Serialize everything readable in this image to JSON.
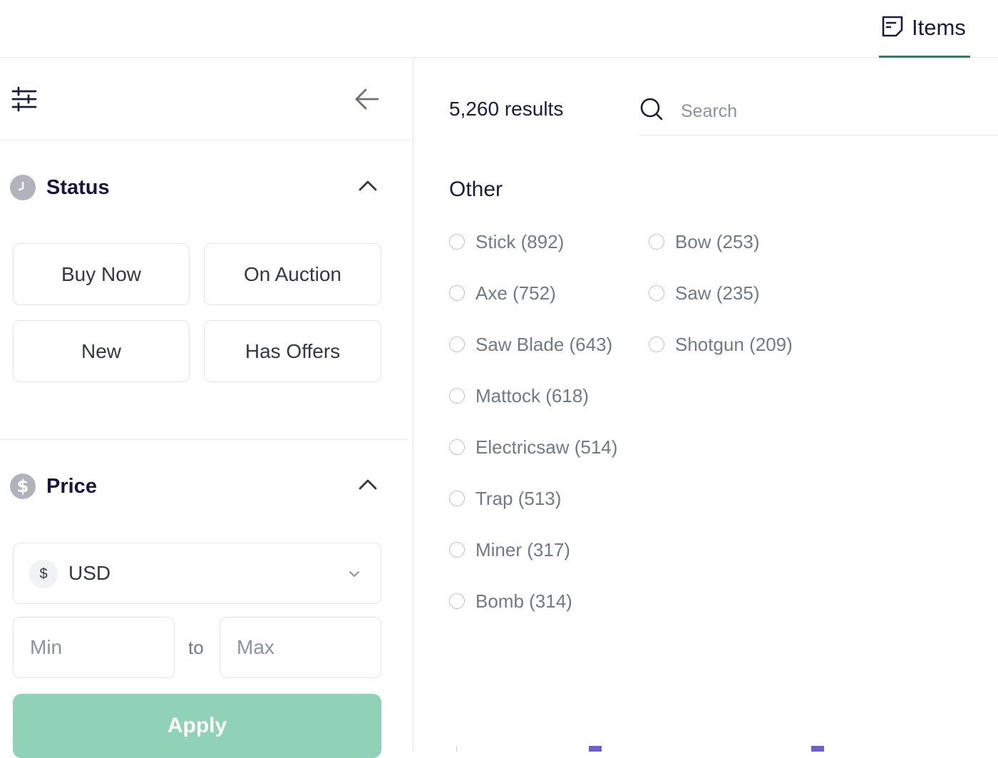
{
  "header": {
    "items_tab_label": "Items"
  },
  "sidebar": {
    "status": {
      "title": "Status",
      "chips": [
        "Buy Now",
        "On Auction",
        "New",
        "Has Offers"
      ]
    },
    "price": {
      "title": "Price",
      "currency_symbol": "$",
      "currency": "USD",
      "min_placeholder": "Min",
      "to_label": "to",
      "max_placeholder": "Max",
      "apply_label": "Apply"
    }
  },
  "main": {
    "results_count": "5,260 results",
    "search_placeholder": "Search",
    "group_title": "Other",
    "options": [
      {
        "label": "Stick (892)"
      },
      {
        "label": "Axe (752)"
      },
      {
        "label": "Saw Blade (643)"
      },
      {
        "label": "Mattock (618)"
      },
      {
        "label": "Electricsaw (514)"
      },
      {
        "label": "Trap (513)"
      },
      {
        "label": "Miner (317)"
      },
      {
        "label": "Bomb (314)"
      },
      {
        "label": "Bow (253)"
      },
      {
        "label": "Saw (235)"
      },
      {
        "label": "Shotgun (209)"
      }
    ]
  },
  "colors": {
    "accent_green": "#2e7d62",
    "apply_bg": "#8fd2b8",
    "peek_purple": "#6f5bd3"
  }
}
